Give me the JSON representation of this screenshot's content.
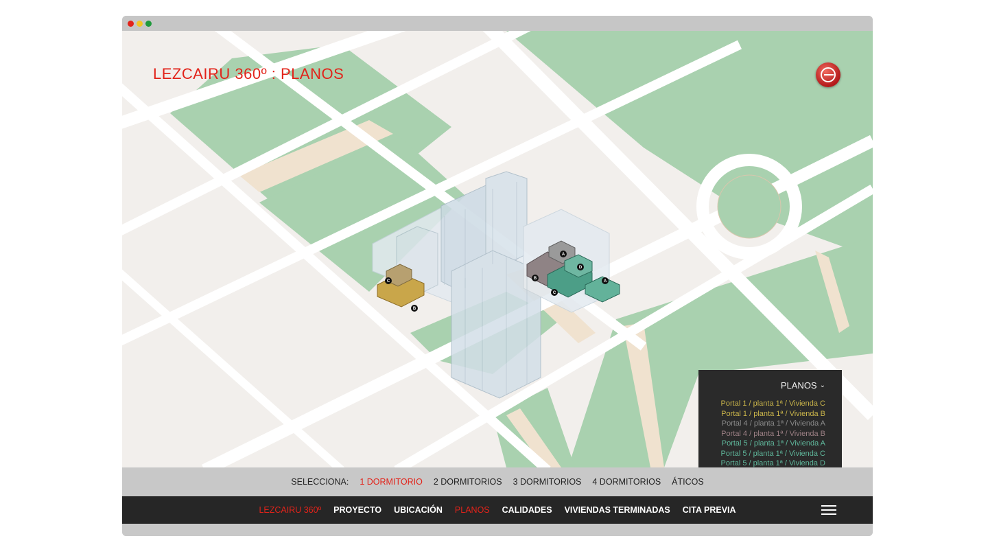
{
  "title": "LEZCAIRU 360º : PLANOS",
  "planos_panel": {
    "header": "PLANOS",
    "items": [
      {
        "label": "Portal 1 / planta 1ª / Vivienda C",
        "color": "#c9b44a"
      },
      {
        "label": "Portal 1 / planta 1ª / Vivienda B",
        "color": "#c9b44a"
      },
      {
        "label": "Portal 4 / planta 1ª / Vivienda A",
        "color": "#8a8a8a"
      },
      {
        "label": "Portal 4 / planta 1ª / Vivienda B",
        "color": "#9b7f84"
      },
      {
        "label": "Portal 5 / planta 1ª / Vivienda A",
        "color": "#5fb79b"
      },
      {
        "label": "Portal 5 / planta 1ª / Vivienda C",
        "color": "#5fb79b"
      },
      {
        "label": "Portal 5 / planta 1ª / Vivienda D",
        "color": "#5fb79b"
      }
    ]
  },
  "selector": {
    "label": "SELECCIONA:",
    "options": [
      "1 DORMITORIO",
      "2 DORMITORIOS",
      "3 DORMITORIOS",
      "4 DORMITORIOS",
      "ÁTICOS"
    ],
    "active": "1 DORMITORIO"
  },
  "nav": {
    "brand": "LEZCAIRU 360º",
    "items": [
      "PROYECTO",
      "UBICACIÓN",
      "PLANOS",
      "CALIDADES",
      "VIVIENDAS TERMINADAS",
      "CITA PREVIA"
    ],
    "active": "PLANOS"
  },
  "map_markers": {
    "portal1": [
      "C",
      "B"
    ],
    "portal4": [
      "A",
      "B"
    ],
    "portal5": [
      "D",
      "C",
      "A"
    ]
  },
  "colors": {
    "accent": "#e2231a",
    "park": "#a9d1af",
    "road": "#ffffff",
    "block": "#f2efec",
    "path": "#f0e2cf"
  },
  "icons": {
    "logo": "company-logo-icon",
    "chevron": "chevron-down-icon",
    "menu": "hamburger-menu-icon"
  }
}
